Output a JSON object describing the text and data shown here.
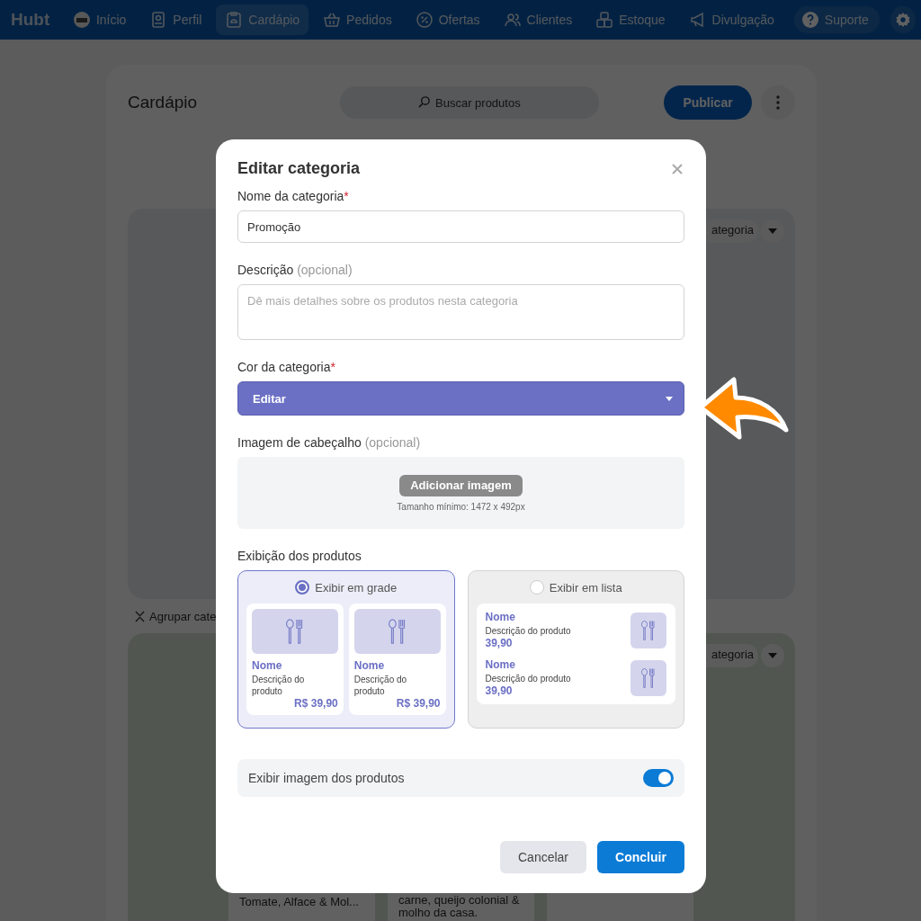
{
  "nav": {
    "logo": "Hubt",
    "items": [
      {
        "label": "Início",
        "selected": false
      },
      {
        "label": "Perfil",
        "selected": false
      },
      {
        "label": "Cardápio",
        "selected": true
      },
      {
        "label": "Pedidos",
        "selected": false
      },
      {
        "label": "Ofertas",
        "selected": false
      },
      {
        "label": "Clientes",
        "selected": false
      },
      {
        "label": "Estoque",
        "selected": false
      },
      {
        "label": "Divulgação",
        "selected": false
      }
    ],
    "support": "Suporte"
  },
  "page": {
    "title": "Cardápio",
    "search": {
      "placeholder": "Buscar produtos"
    },
    "publish": "Publicar",
    "categories": [
      {
        "chip": "ategoria"
      },
      {
        "chip": "ategoria"
      }
    ],
    "group_link": "Agrupar cate",
    "products": [
      {
        "description": "Tomate, Alface & Mol..."
      },
      {
        "description": "carne, queijo colonial & molho da casa."
      }
    ]
  },
  "dialog": {
    "title": "Editar categoria",
    "name": {
      "label": "Nome da categoria",
      "required_mark": "*",
      "value": "Promoção"
    },
    "description": {
      "label": "Descrição",
      "optional": "(opcional)",
      "placeholder": "Dê mais detalhes sobre os produtos nesta categoria"
    },
    "color": {
      "label": "Cor da categoria",
      "required_mark": "*",
      "value": "Editar"
    },
    "header_image": {
      "label": "Imagem de cabeçalho",
      "optional": "(opcional)",
      "button": "Adicionar imagem",
      "hint": "Tamanho mínimo: 1472 x 492px"
    },
    "display": {
      "label": "Exibição dos produtos",
      "options": [
        {
          "kind": "grid",
          "label": "Exibir em grade",
          "selected": true,
          "items": [
            {
              "name": "Nome",
              "description": "Descrição do produto",
              "price": "R$ 39,90"
            },
            {
              "name": "Nome",
              "description": "Descrição do produto",
              "price": "R$ 39,90"
            }
          ]
        },
        {
          "kind": "list",
          "label": "Exibir em lista",
          "selected": false,
          "items": [
            {
              "name": "Nome",
              "description": "Descrição do produto",
              "price": "39,90"
            },
            {
              "name": "Nome",
              "description": "Descrição do produto",
              "price": "39,90"
            }
          ]
        }
      ]
    },
    "show_images": {
      "label": "Exibir imagem dos produtos",
      "on": true
    },
    "buttons": {
      "cancel": "Cancelar",
      "confirm": "Concluir"
    }
  }
}
